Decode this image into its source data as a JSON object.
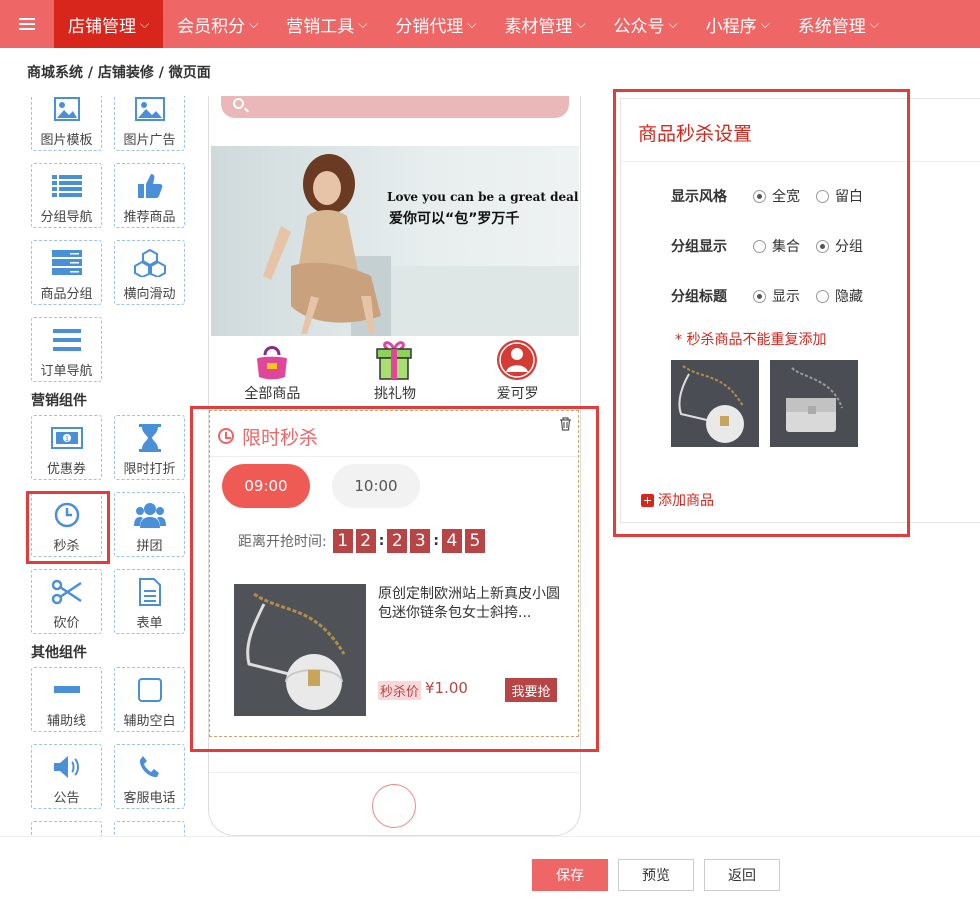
{
  "topnav": {
    "menu_icon": "hamburger-icon",
    "items": [
      {
        "label": "店铺管理"
      },
      {
        "label": "会员积分"
      },
      {
        "label": "营销工具"
      },
      {
        "label": "分销代理"
      },
      {
        "label": "素材管理"
      },
      {
        "label": "公众号"
      },
      {
        "label": "小程序"
      },
      {
        "label": "系统管理"
      }
    ],
    "active_index": 0,
    "active_color": "#d9261c",
    "bar_color": "#ee6666"
  },
  "breadcrumb": "商城系统 / 店铺装修 / 微页面",
  "components": {
    "basic": [
      {
        "label": "图片模板",
        "icon": "image-template-icon"
      },
      {
        "label": "图片广告",
        "icon": "image-ad-icon"
      },
      {
        "label": "分组导航",
        "icon": "group-nav-icon"
      },
      {
        "label": "推荐商品",
        "icon": "thumbs-up-icon"
      },
      {
        "label": "商品分组",
        "icon": "server-icon"
      },
      {
        "label": "横向滑动",
        "icon": "cubes-icon"
      },
      {
        "label": "订单导航",
        "icon": "list-icon"
      }
    ],
    "marketing_title": "营销组件",
    "marketing": [
      {
        "label": "优惠券",
        "icon": "coupon-icon"
      },
      {
        "label": "限时打折",
        "icon": "hourglass-icon"
      },
      {
        "label": "秒杀",
        "icon": "clock-icon"
      },
      {
        "label": "拼团",
        "icon": "group-users-icon"
      },
      {
        "label": "砍价",
        "icon": "scissors-icon"
      },
      {
        "label": "表单",
        "icon": "form-icon"
      }
    ],
    "other_title": "其他组件",
    "other": [
      {
        "label": "辅助线",
        "icon": "divider-line-icon"
      },
      {
        "label": "辅助空白",
        "icon": "blank-square-icon"
      },
      {
        "label": "公告",
        "icon": "speaker-icon"
      },
      {
        "label": "客服电话",
        "icon": "phone-icon"
      }
    ]
  },
  "phone": {
    "banner": {
      "slogan_en": "Love you can be a great deal",
      "slogan_cn": "爱你可以“包”罗万千"
    },
    "quicknav": [
      {
        "label": "全部商品",
        "icon": "handbag-icon"
      },
      {
        "label": "挑礼物",
        "icon": "gift-icon"
      },
      {
        "label": "爱可罗",
        "icon": "avatar-icon"
      }
    ],
    "seckill": {
      "title": "限时秒杀",
      "slots": [
        "09:00",
        "10:00"
      ],
      "countdown_label": "距离开抢时间:",
      "countdown": [
        "1",
        "2",
        "2",
        "3",
        "4",
        "5"
      ],
      "product_name": "原创定制欧洲站上新真皮小圆包迷你链条包女士斜挎...",
      "price_tag": "秒杀价",
      "price": "¥1.00",
      "buy_label": "我要抢"
    }
  },
  "panel": {
    "title": "商品秒杀设置",
    "style_label": "显示风格",
    "style_options": [
      "全宽",
      "留白"
    ],
    "style_selected": "全宽",
    "group_label": "分组显示",
    "group_options": [
      "集合",
      "分组"
    ],
    "group_selected": "分组",
    "group_title_label": "分组标题",
    "group_title_options": [
      "显示",
      "隐藏"
    ],
    "group_title_selected": "显示",
    "warning": "* 秒杀商品不能重复添加",
    "add_label": "添加商品"
  },
  "footer": {
    "save": "保存",
    "preview": "预览",
    "back": "返回"
  }
}
